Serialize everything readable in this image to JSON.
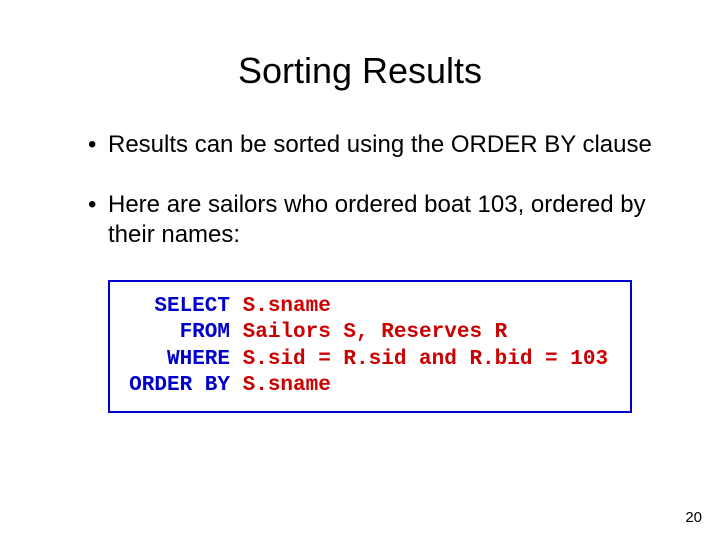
{
  "title": "Sorting Results",
  "bullets": [
    "Results can be sorted using the ORDER BY clause",
    "Here are sailors who ordered boat 103, ordered by their names:"
  ],
  "code": {
    "lines": [
      {
        "kw": "SELECT",
        "rest": "S.sname"
      },
      {
        "kw": "FROM",
        "rest": "Sailors S, Reserves R"
      },
      {
        "kw": "WHERE",
        "rest": "S.sid = R.sid and R.bid = 103"
      },
      {
        "kw": "ORDER BY",
        "rest": "S.sname"
      }
    ]
  },
  "page_number": "20"
}
